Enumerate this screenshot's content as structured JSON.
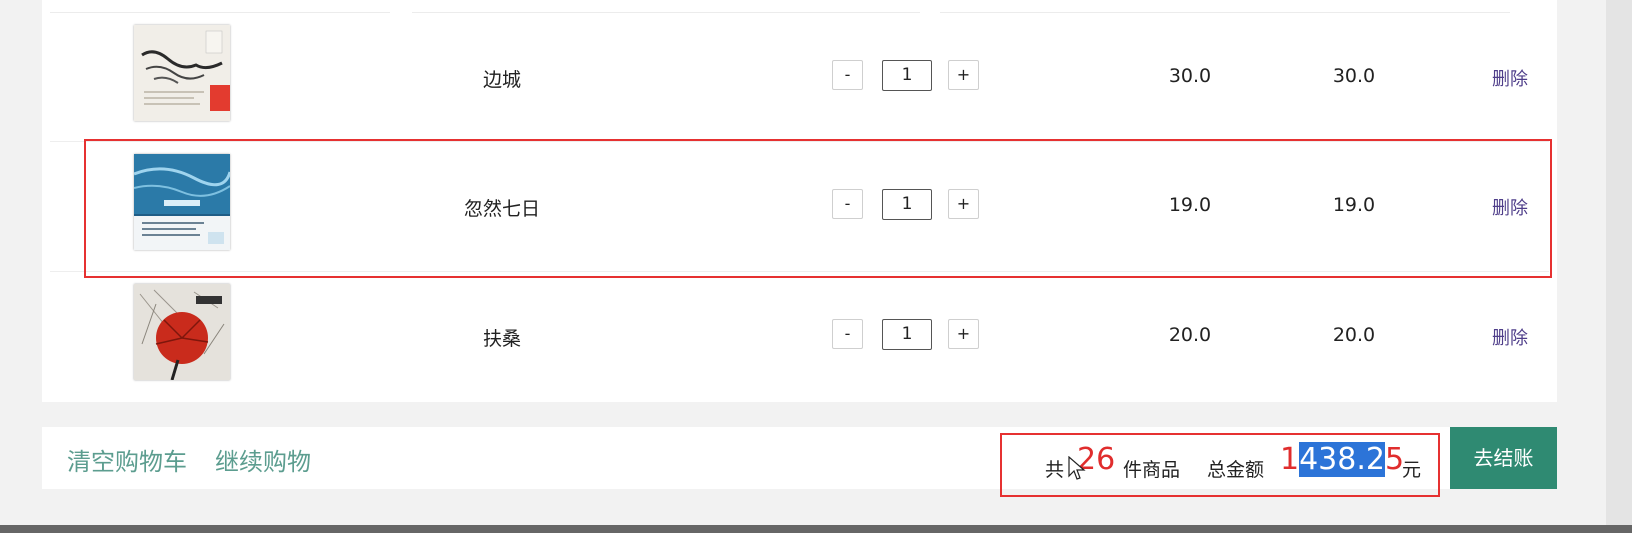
{
  "cart": {
    "items": [
      {
        "title": "边城",
        "quantity": "1",
        "price": "30.0",
        "subtotal": "30.0",
        "delete_label": "删除",
        "minus_label": "-",
        "plus_label": "+",
        "cover_colors": [
          "#f1eee8",
          "#2a2a2a",
          "#e33b2f"
        ]
      },
      {
        "title": "忽然七日",
        "quantity": "1",
        "price": "19.0",
        "subtotal": "19.0",
        "delete_label": "删除",
        "minus_label": "-",
        "plus_label": "+",
        "cover_colors": [
          "#1f5d86",
          "#9fd4ee",
          "#ffffff"
        ]
      },
      {
        "title": "扶桑",
        "quantity": "1",
        "price": "20.0",
        "subtotal": "20.0",
        "delete_label": "删除",
        "minus_label": "-",
        "plus_label": "+",
        "cover_colors": [
          "#e5e2dc",
          "#c92b1c",
          "#333333"
        ]
      }
    ]
  },
  "footer": {
    "clear_cart": "清空购物车",
    "continue_shopping": "继续购物",
    "total_prefix": "共",
    "item_count": "26",
    "item_suffix": "件商品",
    "amount_label": "总金额",
    "amount_parts": [
      "1",
      "438.2",
      "5"
    ],
    "currency": "元",
    "checkout": "去结账"
  },
  "colors": {
    "accent_red": "#e02d2d",
    "link_teal": "#5c9d8f",
    "checkout_green": "#2f8a72",
    "delete_purple": "#4f3e8a",
    "selection_blue": "#2c74d8"
  },
  "icons": [
    "mouse-cursor-icon"
  ]
}
